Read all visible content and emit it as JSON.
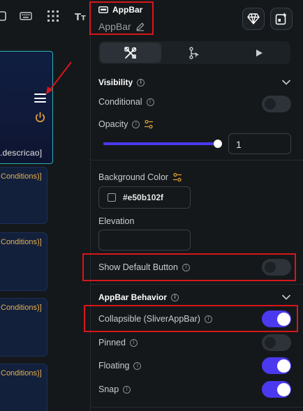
{
  "canvas": {
    "desc_text": ".descricao]",
    "cards": [
      {
        "label": "Conditions)]"
      },
      {
        "label": "Conditions)]"
      },
      {
        "label": "Conditions)]"
      },
      {
        "label": "Conditions)]"
      }
    ]
  },
  "header": {
    "title": "AppBar",
    "subtitle": "AppBar"
  },
  "tabs": [
    {
      "name": "properties",
      "icon": "tools-icon",
      "active": true
    },
    {
      "name": "actions",
      "icon": "flow-icon",
      "active": false
    },
    {
      "name": "preview",
      "icon": "play-icon",
      "active": false
    }
  ],
  "visibility": {
    "title": "Visibility",
    "conditional_label": "Conditional",
    "conditional_on": false,
    "opacity_label": "Opacity",
    "opacity_value": "1",
    "opacity_fraction": 1.0
  },
  "background": {
    "label": "Background Color",
    "color_value": "#e50b102f",
    "elevation_label": "Elevation",
    "elevation_value": ""
  },
  "show_default_button": {
    "label": "Show Default Button",
    "on": false
  },
  "appbar_behavior": {
    "title": "AppBar Behavior",
    "collapsible_label": "Collapsible (SliverAppBar)",
    "collapsible_on": true,
    "pinned_label": "Pinned",
    "pinned_on": false,
    "floating_label": "Floating",
    "floating_on": true,
    "snap_label": "Snap",
    "snap_on": true
  },
  "colors": {
    "accent": "#4b39ef",
    "highlight": "#d7161b",
    "warning": "#e8b04a"
  }
}
